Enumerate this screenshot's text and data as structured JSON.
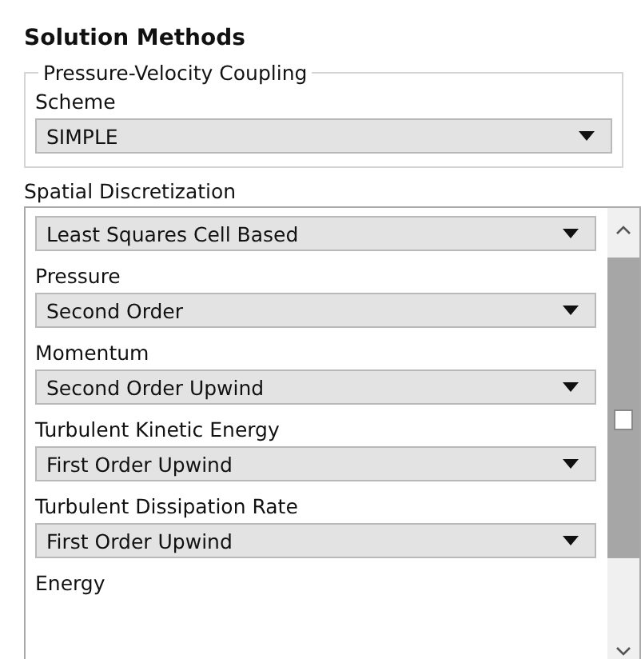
{
  "title": "Solution Methods",
  "coupling": {
    "legend": "Pressure-Velocity Coupling",
    "label": "Scheme",
    "value": "SIMPLE"
  },
  "discretization": {
    "heading": "Spatial Discretization",
    "items": [
      {
        "value": "Least Squares Cell Based"
      },
      {
        "label": "Pressure",
        "value": "Second Order"
      },
      {
        "label": "Momentum",
        "value": "Second Order Upwind"
      },
      {
        "label": "Turbulent Kinetic Energy",
        "value": "First Order Upwind"
      },
      {
        "label": "Turbulent Dissipation Rate",
        "value": "First Order Upwind"
      },
      {
        "label": "Energy"
      }
    ]
  }
}
